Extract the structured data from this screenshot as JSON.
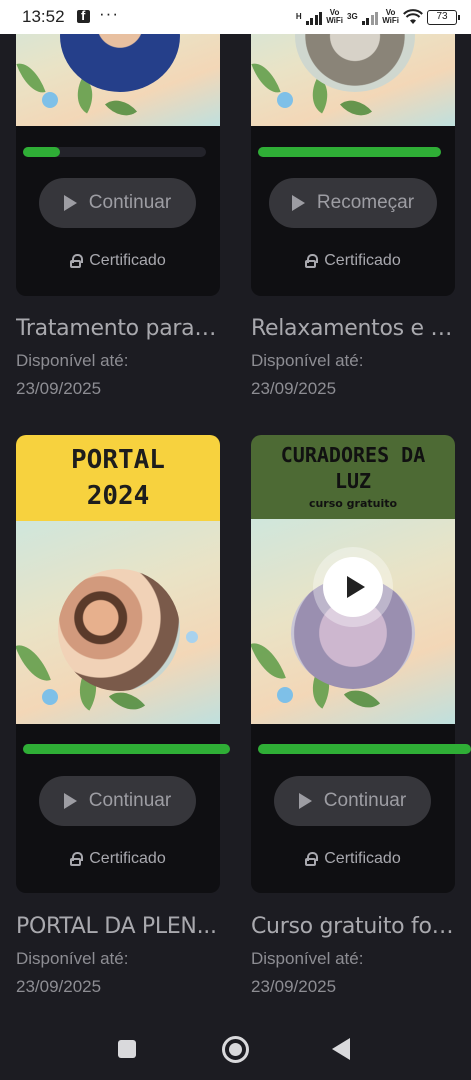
{
  "status_bar": {
    "time": "13:52",
    "notification_app": "facebook-icon",
    "more": "···",
    "net1": {
      "top": "H",
      "bottom": ""
    },
    "net2_vo": "Vo",
    "net2_wifi": "WiFi",
    "net3": "3G",
    "net4_vo": "Vo",
    "net4_wifi": "WiFi",
    "battery": "73"
  },
  "courses": [
    {
      "title": "Tratamento para ...",
      "progress": 0.2,
      "button_label": "Continuar",
      "certificate_label": "Certificado",
      "available_label": "Disponível até:",
      "available_date": "23/09/2025"
    },
    {
      "title": "Relaxamentos e tr...",
      "progress": 0.9,
      "button_label": "Recomeçar",
      "certificate_label": "Certificado",
      "available_label": "Disponível até:",
      "available_date": "23/09/2025"
    },
    {
      "title": "PORTAL DA PLEN...",
      "header_line1": "PORTAL",
      "header_line2": "2024",
      "progress": 1.0,
      "button_label": "Continuar",
      "certificate_label": "Certificado",
      "available_label": "Disponível até:",
      "available_date": "23/09/2025"
    },
    {
      "title": "Curso gratuito for...",
      "header_line1": "CURADORES DA",
      "header_line2": "LUZ",
      "header_line3": "curso gratuito",
      "progress": 1.0,
      "button_label": "Continuar",
      "certificate_label": "Certificado",
      "available_label": "Disponível até:",
      "available_date": "23/09/2025"
    }
  ],
  "colors": {
    "background": "#1c1c22",
    "card": "#0f0f12",
    "progress": "#2fae36",
    "button": "#36363b",
    "portal_header": "#f7d23e",
    "curadores_header": "#4d6a34"
  }
}
